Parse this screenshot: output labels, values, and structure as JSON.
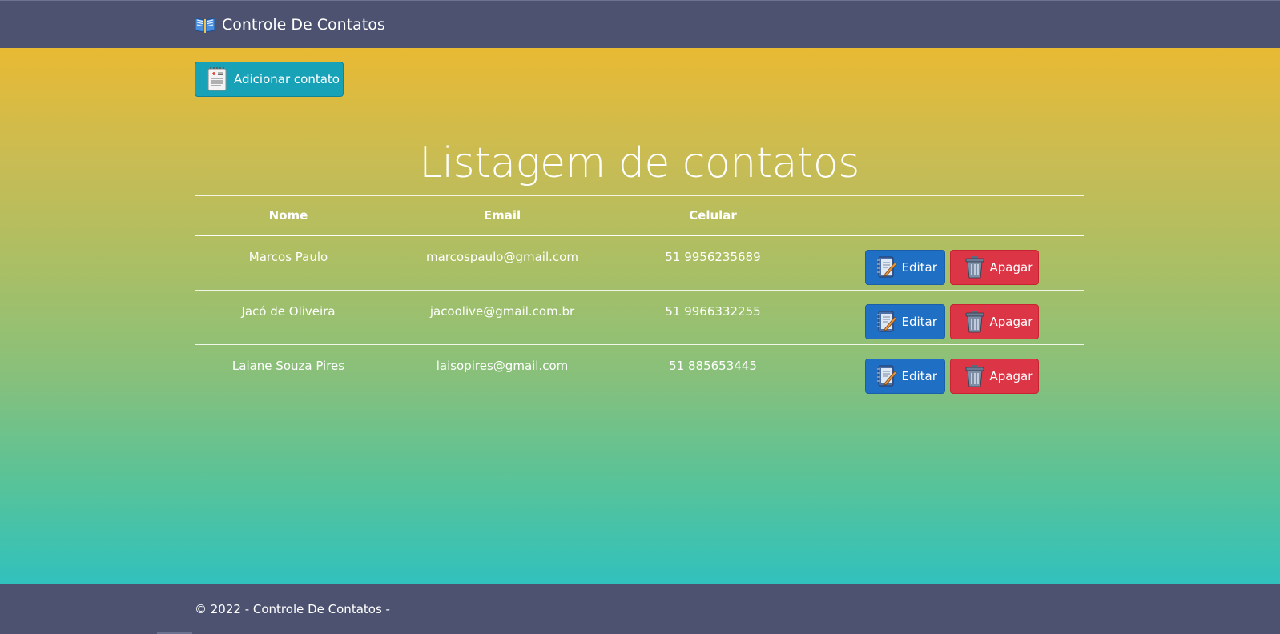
{
  "navbar": {
    "brand": "Controle De Contatos",
    "brand_icon": "open-book-icon"
  },
  "toolbar": {
    "add_label": "Adicionar contato",
    "add_icon": "notepad-icon"
  },
  "page": {
    "title": "Listagem de contatos"
  },
  "table": {
    "headers": {
      "nome": "Nome",
      "email": "Email",
      "celular": "Celular",
      "actions": ""
    },
    "rows": [
      {
        "nome": "Marcos Paulo",
        "email": "marcospaulo@gmail.com",
        "celular": "51 9956235689"
      },
      {
        "nome": "Jacó de Oliveira",
        "email": "jacoolive@gmail.com.br",
        "celular": "51 9966332255"
      },
      {
        "nome": "Laiane Souza Pires",
        "email": "laisopires@gmail.com",
        "celular": "51 885653445"
      }
    ],
    "edit_label": "Editar",
    "delete_label": "Apagar",
    "edit_icon": "notebook-pencil-icon",
    "delete_icon": "trash-can-icon"
  },
  "footer": {
    "text": "© 2022 - Controle De Contatos -"
  },
  "colors": {
    "navbar": "#4c5270",
    "add_button": "#17a2b8",
    "edit_button": "#1f6fc4",
    "delete_button": "#dc3545",
    "gradient_top": "#e9ba33",
    "gradient_bottom": "#31c1bd"
  }
}
